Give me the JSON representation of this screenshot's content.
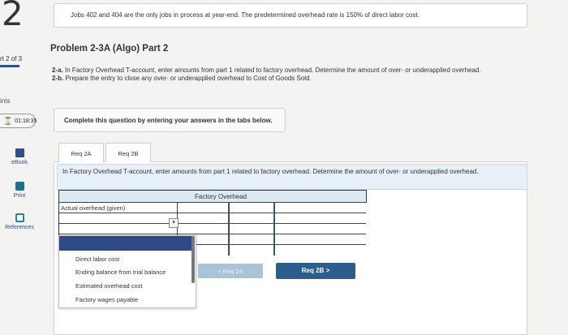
{
  "page": {
    "number": "2",
    "part_label": "rt 2 of 3",
    "points_label": "ints",
    "timer": "01:18:35"
  },
  "sidebar": {
    "tools": [
      {
        "label": "eBook",
        "icon": "book-icon"
      },
      {
        "label": "Print",
        "icon": "print-icon"
      },
      {
        "label": "References",
        "icon": "references-icon"
      }
    ]
  },
  "intro": "Jobs 402 and 404 are the only jobs in process at year-end. The predetermined overhead rate is 150% of direct labor cost.",
  "problem": {
    "title": "Problem 2-3A (Algo) Part 2",
    "line_a_label": "2-a.",
    "line_a": "In Factory Overhead T-account, enter amounts from part 1 related to factory overhead. Determine the amount of over- or underapplied overhead.",
    "line_b_label": "2-b.",
    "line_b": "Prepare the entry to close any over- or underapplied overhead to Cost of Goods Sold."
  },
  "complete_note": "Complete this question by entering your answers in the tabs below.",
  "tabs": [
    {
      "label": "Req 2A"
    },
    {
      "label": "Req 2B"
    }
  ],
  "panel_message": "In Factory Overhead T-account, enter amounts from part 1 related to factory overhead. Determine the amount of over- or underapplied overhead.",
  "t_account": {
    "title": "Factory Overhead",
    "first_row_label": "Actual overhead (given)"
  },
  "dropdown": {
    "options": [
      "Direct labor cost",
      "Ending balance from trial balance",
      "Estimated overhead cost",
      "Factory wages payable"
    ]
  },
  "navigation": {
    "prev_label": "Req 2A",
    "next_label": "Req 2B",
    "prev_symbol": "<",
    "next_symbol": ">"
  },
  "colors": {
    "primary": "#2b5d8d",
    "header_blue": "#dce8f2",
    "highlight": "#2d4a86"
  }
}
